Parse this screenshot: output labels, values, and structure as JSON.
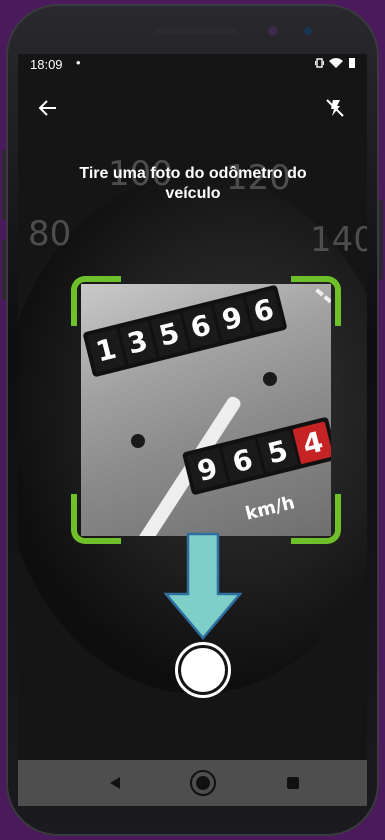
{
  "status_bar": {
    "time": "18:09",
    "notification_dot": "•",
    "icons": [
      "vibrate-icon",
      "wifi-icon",
      "battery-icon"
    ]
  },
  "toolbar": {
    "back_icon": "arrow-left-icon",
    "flash_icon": "flash-off-icon"
  },
  "instruction": "Tire uma foto do odômetro do veículo",
  "background_dial": {
    "numbers": [
      "80",
      "100",
      "120",
      "140"
    ]
  },
  "odometer_photo": {
    "total_digits": [
      "1",
      "3",
      "5",
      "6",
      "9",
      "6"
    ],
    "trip_digits": [
      "9",
      "6",
      "5",
      "4"
    ],
    "unit": "km/h"
  },
  "capture": {
    "pointer_icon": "arrow-down-icon",
    "shutter_icon": "shutter-button-icon"
  },
  "navigation": {
    "back": "nav-back-icon",
    "home": "nav-home-icon",
    "recents": "nav-recents-icon"
  },
  "colors": {
    "frame_corners": "#6fbf2a",
    "arrow_fill": "#7ecfc8",
    "arrow_stroke": "#2f6fa0",
    "odometer_red": "#c62424",
    "navbar": "#4e4e4e"
  }
}
